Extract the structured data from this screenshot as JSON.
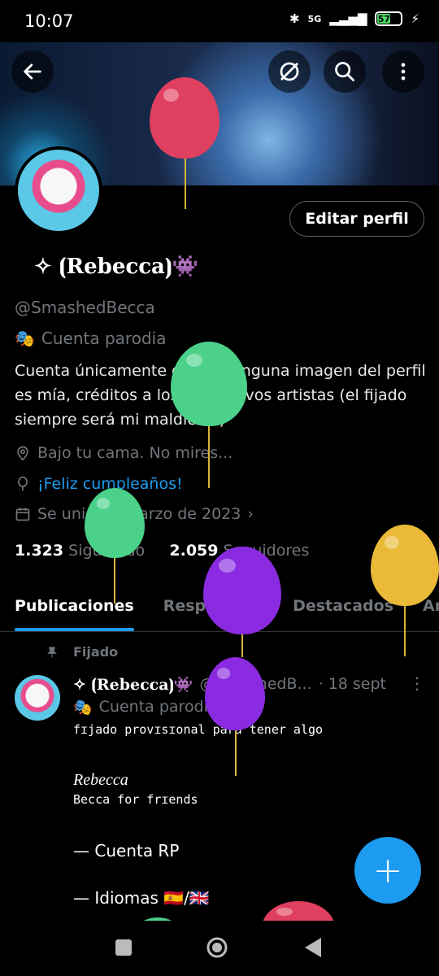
{
  "status_bar": {
    "time": "10:07",
    "network": "5G",
    "battery": "57"
  },
  "header": {
    "back_icon": "arrow-left-icon",
    "grok_icon": "slash-circle-icon",
    "search_icon": "search-icon",
    "more_icon": "more-vertical-icon"
  },
  "profile": {
    "edit_label": "Editar perfil",
    "display_name": "✧ ⦗Rebecca⦘👾",
    "handle": "@SmashedBecca",
    "parody_label": "Cuenta parodia",
    "bio": "Cuenta únicamente de rol. Ninguna imagen del perfil es mía, créditos a los respectivos artistas  (el fijado siempre será mi maldición)",
    "location": "Bajo tu cama. No mires...",
    "birthday": "¡Feliz cumpleaños!",
    "joined": "Se unió en marzo de 2023",
    "following_count": "1.323",
    "following_label": "Siguiendo",
    "followers_count": "2.059",
    "followers_label": "Seguidores"
  },
  "tabs": [
    "Publicaciones",
    "Respuestas",
    "Destacados",
    "Ar"
  ],
  "post": {
    "pinned_label": "Fijado",
    "name": "✧ ⦗Rebecca⦘👾",
    "handle": "@SmashedB...",
    "date": "· 18 sept",
    "parody_label": "Cuenta parodia",
    "line1": "fɪjado provɪsɪonal para tener algo",
    "line2": "Rebecca",
    "line3": "Becca for frɪends",
    "line4": "— Cuenta RP",
    "line5": "— Idiomas 🇪🇸/🇬🇧"
  },
  "fab_icon": "plus-icon",
  "colors": {
    "accent": "#1d9bf0",
    "balloon_red": "#e0405f",
    "balloon_green": "#4cd18a",
    "balloon_purple": "#8a2be2",
    "balloon_yellow": "#e9b937"
  }
}
